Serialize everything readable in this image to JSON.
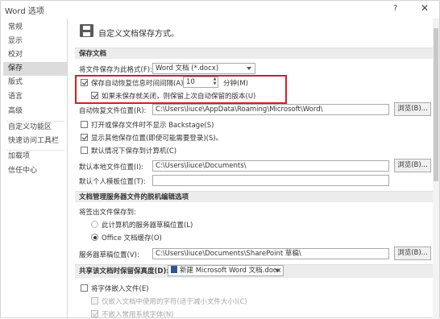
{
  "window": {
    "title": "Word 选项",
    "help": "?",
    "close": "✕"
  },
  "sidebar": {
    "items": [
      {
        "label": "常规",
        "selected": false
      },
      {
        "label": "显示",
        "selected": false
      },
      {
        "label": "校对",
        "selected": false
      },
      {
        "label": "保存",
        "selected": true
      },
      {
        "label": "版式",
        "selected": false
      },
      {
        "label": "语言",
        "selected": false
      },
      {
        "label": "高级",
        "selected": false
      },
      {
        "label": "自定义功能区",
        "selected": false
      },
      {
        "label": "快速访问工具栏",
        "selected": false
      },
      {
        "label": "加载项",
        "selected": false
      },
      {
        "label": "信任中心",
        "selected": false
      }
    ]
  },
  "header": {
    "title": "自定义文档保存方式。",
    "icon": "save-disk-icon"
  },
  "save_docs": {
    "section": "保存文档",
    "format_label": "将文件保存为此格式(F):",
    "format_value": "Word 文档 (*.docx)",
    "autorecover_label": "保存自动恢复信息时间间隔(A)",
    "autorecover_checked": true,
    "autorecover_minutes": "10",
    "minutes_label": "分钟(M)",
    "keep_last_label": "如果未保存就关闭，则保留上次自动保留的版本(U)",
    "keep_last_checked": true,
    "autorecover_location_label": "自动恢复文件位置(R):",
    "autorecover_location_value": "C:\\Users\\liuce\\AppData\\Roaming\\Microsoft\\Word\\",
    "browse1": "浏览(B)...",
    "backstage_label": "打开或保存文件时不显示 Backstage(S)",
    "backstage_checked": false,
    "show_extra_label": "显示其他保存位置(即使可能需要登录)(S)。",
    "show_extra_checked": true,
    "default_computer_label": "默认情况下保存到计算机(C)",
    "default_computer_checked": false,
    "default_local_label": "默认本地文件位置(I):",
    "default_local_value": "C:\\Users\\liuce\\Documents\\",
    "browse2": "浏览(B)...",
    "personal_templates_label": "默认个人模板位置(T):",
    "personal_templates_value": ""
  },
  "offline": {
    "section": "文档管理服务器文件的脱机编辑选项",
    "save_to_label": "将签出文件保存到:",
    "option1": "此计算机的服务器草稿位置(L)",
    "option2": "Office 文档缓存(O)",
    "selected": "option2",
    "drafts_label": "服务器草稿位置(V):",
    "drafts_value": "C:\\Users\\liuce\\Documents\\SharePoint 草稿\\",
    "browse3": "浏览(B)..."
  },
  "fidelity": {
    "section": "共享该文档时保留保真度(D):",
    "document": "新建 Microsoft Word 文档.docx",
    "embed_fonts_label": "将字体嵌入文件(E)",
    "embed_fonts_checked": false,
    "embed_used_label": "仅嵌入文档中使用的字符(适于减小文件大小)(C)",
    "embed_used_checked": false,
    "no_common_label": "不嵌入常用系统字体(N)",
    "no_common_checked": true
  }
}
